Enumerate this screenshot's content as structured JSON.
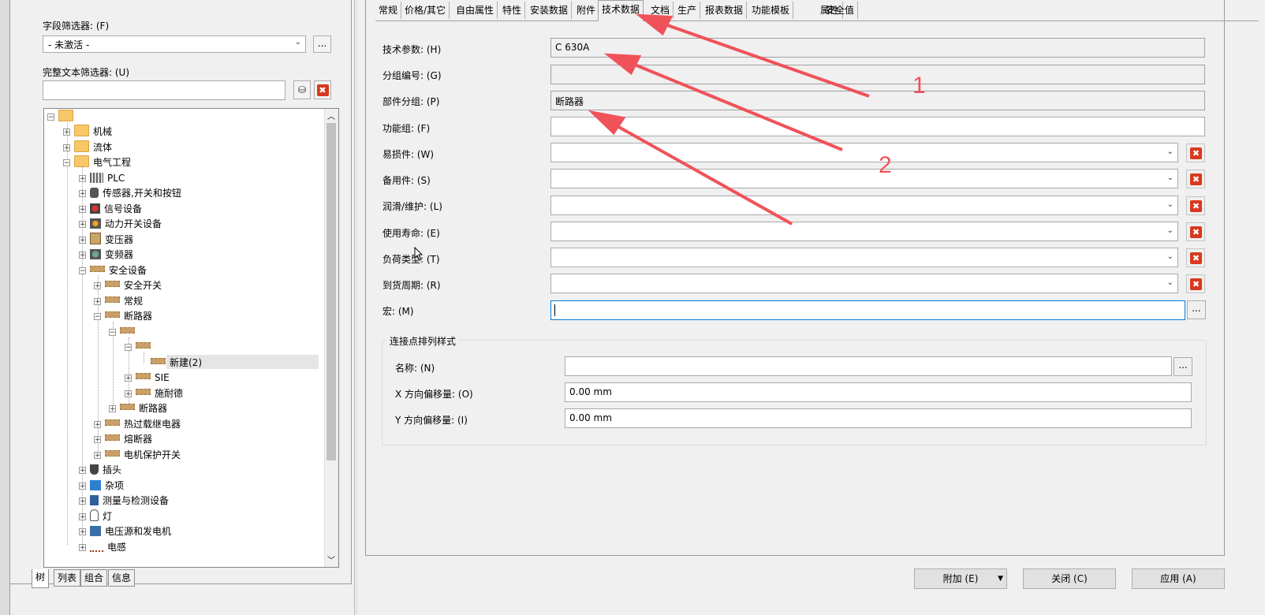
{
  "left": {
    "field_filter_label": "字段筛选器: (F)",
    "field_filter_value": "- 未激活 -",
    "dots_label": "...",
    "fulltext_filter_label": "完整文本筛选器: (U)",
    "fulltext_value": "",
    "binoculars_glyph": "⛁",
    "clear_glyph": "✖",
    "tree": {
      "root": "",
      "n1": "机械",
      "n2": "流体",
      "n3": "电气工程",
      "n4": "PLC",
      "n5": "传感器,开关和按钮",
      "n6": "信号设备",
      "n7": "动力开关设备",
      "n8": "变压器",
      "n9": "变频器",
      "n10": "安全设备",
      "n11": "安全开关",
      "n12": "常规",
      "n13": "断路器",
      "n14": "",
      "n15": "",
      "n16": "新建(2)",
      "n17": "SIE",
      "n18": "施耐德",
      "n19": "断路器",
      "n20": "热过载继电器",
      "n21": "熔断器",
      "n22": "电机保护开关",
      "n23": "插头",
      "n24": "杂项",
      "n25": "测量与检测设备",
      "n26": "灯",
      "n27": "电压源和发电机",
      "n28": "电感"
    },
    "bottom_tabs": [
      "树",
      "列表",
      "组合",
      "信息"
    ]
  },
  "tabs": [
    "常规",
    "价格/其它",
    "自由属性",
    "特性",
    "安装数据",
    "附件",
    "技术数据",
    "文档",
    "生产",
    "报表数据",
    "功能模板",
    "属性",
    "安全值"
  ],
  "active_tab": "技术数据",
  "form": {
    "tech_params_label": "技术参数: (H)",
    "tech_params_value": "C 630A",
    "group_no_label": "分组编号: (G)",
    "group_no_value": "",
    "part_group_label": "部件分组: (P)",
    "part_group_value": "断路器",
    "func_group_label": "功能组: (F)",
    "func_group_value": "",
    "wear_label": "易损件: (W)",
    "spare_label": "备用件: (S)",
    "lube_label": "润滑/维护: (L)",
    "life_label": "使用寿命: (E)",
    "load_label": "负荷类型: (T)",
    "delivery_label": "到货周期: (R)",
    "macro_label": "宏: (M)",
    "macro_value": ""
  },
  "conn": {
    "group_title": "连接点排列样式",
    "name_label": "名称: (N)",
    "name_value": "",
    "x_label": "X 方向偏移量: (O)",
    "x_value": "0.00 mm",
    "y_label": "Y 方向偏移量: (I)",
    "y_value": "0.00 mm"
  },
  "buttons": {
    "attach": "附加 (E)",
    "close": "关闭 (C)",
    "apply": "应用 (A)"
  },
  "annotations": {
    "one": "1",
    "two": "2"
  },
  "colors": {
    "accent": "#0078d7",
    "annotation": "#f0525a",
    "delete": "#d9381e"
  }
}
